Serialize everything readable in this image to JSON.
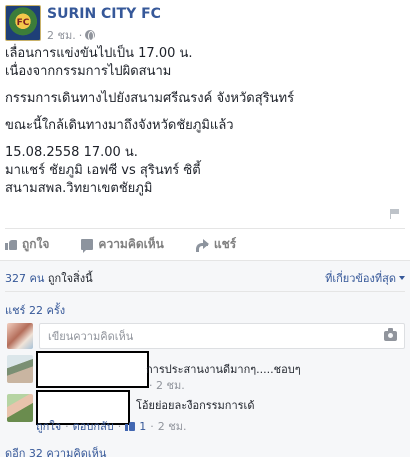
{
  "post": {
    "page_name": "SURIN CITY FC",
    "time": "2 ชม.",
    "body": [
      {
        "lines": [
          "เลื่อนการแข่งขันไปเป็น 17.00 น.",
          "เนื่องจากกรรมการไปผิดสนาม"
        ]
      },
      {
        "lines": [
          "กรรมการเดินทางไปยังสนามศรีณรงค์ จังหวัดสุรินทร์"
        ]
      },
      {
        "lines": [
          "ขณะนี้ใกล้เดินทางมาถึงจังหวัดชัยภูมิแล้ว"
        ]
      },
      {
        "lines": [
          "15.08.2558 17.00 น.",
          "มาแชร์ ชัยภูมิ เอฟซี vs สุรินทร์ ซิตี้",
          "สนามสพล.วิทยาเขตชัยภูมิ"
        ]
      }
    ]
  },
  "actions": {
    "like": "ถูกใจ",
    "comment": "ความคิดเห็น",
    "share": "แชร์"
  },
  "feedback": {
    "likes_count": "327 คน",
    "likes_suffix": " ถูกใจสิ่งนี้",
    "sort_label": "ที่เกี่ยวข้องที่สุด",
    "shares": "แชร์ 22 ครั้ง",
    "composer_placeholder": "เขียนความคิดเห็น",
    "comments": [
      {
        "text": "การประสานงานดีมากๆ.....ชอบๆ",
        "meta": "· 2 ชม."
      },
      {
        "text": "โอ้ยย่อยละงือกรรมการเด้",
        "like": "ถูกใจ",
        "reply": "ตอบกลับ",
        "likes": "1",
        "time": "2 ชม."
      }
    ],
    "view_more": "ดูอีก 32 ความคิดเห็น"
  }
}
